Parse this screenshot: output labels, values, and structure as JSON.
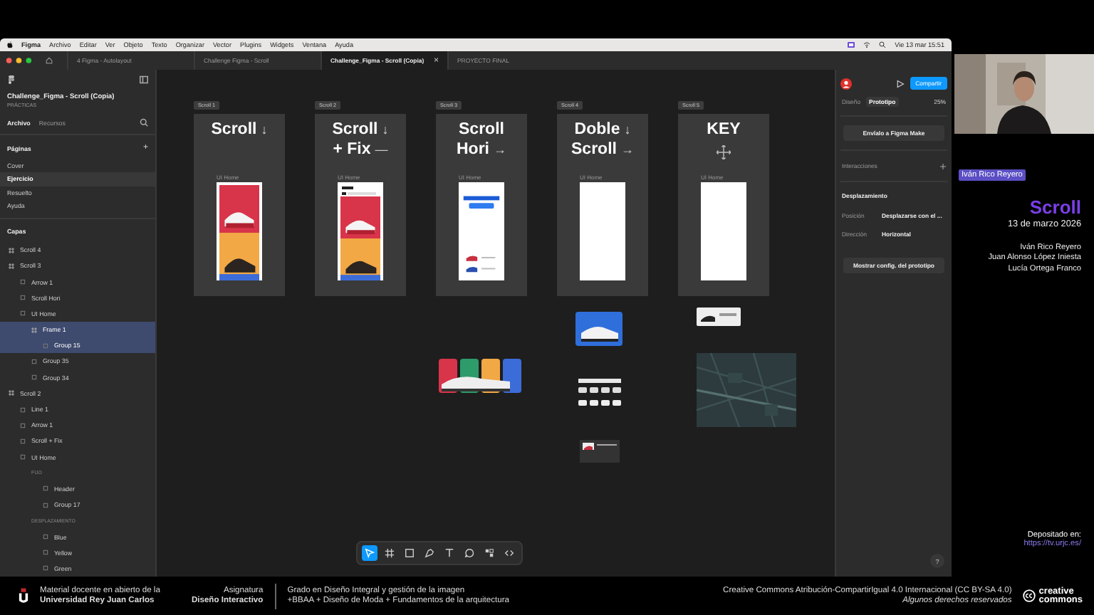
{
  "menu_bar": {
    "items": [
      "Figma",
      "Archivo",
      "Editar",
      "Ver",
      "Objeto",
      "Texto",
      "Organizar",
      "Vector",
      "Plugins",
      "Widgets",
      "Ventana",
      "Ayuda"
    ],
    "clock": "Vie 13 mar 15:51"
  },
  "tabs": [
    {
      "label": "4 Figma - Autolayout",
      "selected": false
    },
    {
      "label": "Challenge Figma - Scroll",
      "selected": false
    },
    {
      "label": "Challenge_Figma - Scroll (Copia)",
      "selected": true,
      "close": "×"
    },
    {
      "label": "PROYECTO FINAL",
      "selected": false
    }
  ],
  "left_panel": {
    "file_title": "Challenge_Figma - Scroll (Copia)",
    "project": "PRÁCTICAS",
    "tabs": [
      {
        "label": "Archivo",
        "selected": true
      },
      {
        "label": "Recursos",
        "selected": false
      }
    ],
    "pages_heading": "Páginas",
    "add": "+",
    "pages": [
      {
        "label": "Cover",
        "selected": false
      },
      {
        "label": "Ejercicio",
        "selected": true
      },
      {
        "label": "Resuelto",
        "selected": false
      },
      {
        "label": "Ayuda",
        "selected": false
      }
    ],
    "layers_heading": "Capas",
    "layers": [
      {
        "label": "Scroll 4",
        "kind": "frame",
        "selected": false
      },
      {
        "label": "Scroll 3",
        "kind": "frame",
        "selected": false,
        "children": [
          {
            "label": "Arrow 1",
            "kind": "layer",
            "selected": false
          },
          {
            "label": "Scroll Hori",
            "kind": "layer",
            "selected": false
          },
          {
            "label": "UI Home",
            "kind": "layer",
            "selected": false,
            "children": [
              {
                "label": "Frame 1",
                "kind": "frame",
                "selected": true,
                "children": [
                  {
                    "label": "Group 15",
                    "kind": "layer",
                    "selected": true
                  }
                ]
              },
              {
                "label": "Group 35",
                "kind": "layer",
                "selected": false
              },
              {
                "label": "Group 34",
                "kind": "layer",
                "selected": false
              }
            ]
          }
        ]
      },
      {
        "label": "Scroll 2",
        "kind": "frame",
        "selected": false,
        "children": [
          {
            "label": "Line 1",
            "kind": "layer",
            "selected": false
          },
          {
            "label": "Arrow 1",
            "kind": "layer",
            "selected": false
          },
          {
            "label": "Scroll + Fix",
            "kind": "layer",
            "selected": false
          },
          {
            "label": "UI Home",
            "kind": "layer",
            "selected": false,
            "children": [
              {
                "label": "FIJO",
                "kind": "section",
                "selected": false,
                "children": [
                  {
                    "label": "Header",
                    "kind": "layer",
                    "selected": false
                  },
                  {
                    "label": "Group 17",
                    "kind": "layer",
                    "selected": false
                  }
                ]
              },
              {
                "label": "DESPLAZAMIENTO",
                "kind": "section",
                "selected": false,
                "children": [
                  {
                    "label": "Blue",
                    "kind": "layer",
                    "selected": false
                  },
                  {
                    "label": "Yellow",
                    "kind": "layer",
                    "selected": false
                  },
                  {
                    "label": "Green",
                    "kind": "layer",
                    "selected": false
                  }
                ]
              }
            ]
          }
        ]
      }
    ]
  },
  "canvas": {
    "frames": [
      {
        "label": "Scroll 1",
        "lines": [
          {
            "text": "Scroll",
            "mark": "↓"
          }
        ],
        "caption": "UI Home",
        "kind": "photos"
      },
      {
        "label": "Scroll 2",
        "lines": [
          {
            "text": "Scroll",
            "mark": "↓"
          },
          {
            "text": "+ Fix",
            "mark": "—"
          }
        ],
        "caption": "UI Home",
        "kind": "header"
      },
      {
        "label": "Scroll 3",
        "lines": [
          {
            "text": "Scroll"
          },
          {
            "text": "Hori",
            "mark": "→"
          }
        ],
        "caption": "UI Home",
        "kind": "list"
      },
      {
        "label": "Scroll 4",
        "lines": [
          {
            "text": "Doble",
            "mark": "↓"
          },
          {
            "text": "Scroll",
            "mark": "→"
          }
        ],
        "caption": "UI Home",
        "kind": "blank"
      },
      {
        "label": "Scroll 5",
        "lines": [
          {
            "text": "KEY"
          }
        ],
        "caption": "UI Home",
        "kind": "key"
      }
    ],
    "toolbar": [
      {
        "kind": "move",
        "selected": true
      },
      {
        "kind": "frame",
        "selected": false
      },
      {
        "kind": "shape",
        "selected": false
      },
      {
        "kind": "pen",
        "selected": false
      },
      {
        "kind": "text",
        "selected": false
      },
      {
        "kind": "comment",
        "selected": false
      },
      {
        "kind": "actions",
        "selected": false
      },
      {
        "kind": "dev",
        "selected": false
      }
    ]
  },
  "right_panel": {
    "share": "Compartir",
    "tabs": [
      {
        "label": "Diseño",
        "selected": false
      },
      {
        "label": "Prototipo",
        "selected": true
      }
    ],
    "zoom": "25%",
    "make_button": "Envíalo a Figma Make",
    "interactions": "Interacciones",
    "scroll_heading": "Desplazamiento",
    "fields": [
      {
        "label": "Posición",
        "value": "Desplazarse con el ..."
      },
      {
        "label": "Dirección",
        "value": "Horizontal"
      }
    ],
    "settings_button": "Mostrar config. del prototipo",
    "help": "?"
  },
  "presenter": {
    "name_tag": "Iván Rico Reyero",
    "title": "Scroll",
    "date": "13 de marzo 2026",
    "authors": [
      "Iván Rico Reyero",
      "Juan Alonso López Iniesta",
      "Lucía Ortega Franco"
    ],
    "deposit_label": "Depositado en:",
    "deposit_link": "https://tv.urjc.es/"
  },
  "footer": {
    "institution": [
      "Material docente en abierto de la",
      "Universidad Rey Juan Carlos"
    ],
    "subject": [
      "Asignatura",
      "Diseño Interactivo"
    ],
    "degree": [
      "Grado en Diseño Integral y gestión de la imagen",
      "+BBAA + Diseño de Moda + Fundamentos de la arquitectura"
    ],
    "license": [
      "Creative Commons Atribución-CompartirIgual 4.0 Internacional (CC BY-SA 4.0)",
      "Algunos derechos reservados"
    ],
    "cc_logo": [
      "creative",
      "commons"
    ]
  }
}
